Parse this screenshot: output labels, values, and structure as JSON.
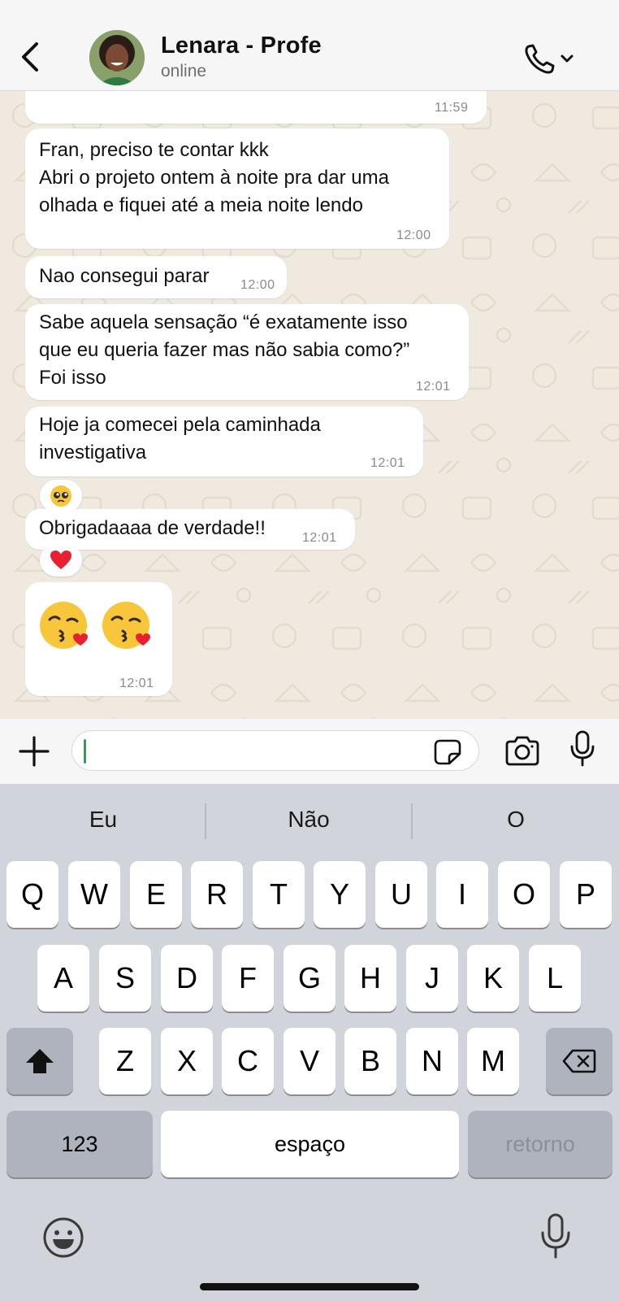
{
  "header": {
    "contact_name": "Lenara - Profe",
    "status": "online",
    "back_icon": "chevron-left-icon",
    "call_icon": "phone-icon"
  },
  "messages": [
    {
      "text": "",
      "time": "11:59"
    },
    {
      "text": "Fran, preciso te contar kkk\nAbri o projeto ontem à noite pra dar uma\nolhada e fiquei até a meia noite lendo",
      "time": "12:00"
    },
    {
      "text": "Nao consegui parar",
      "time": "12:00"
    },
    {
      "text": "Sabe aquela sensação “é exatamente isso\nque eu queria fazer mas não sabia como?”\nFoi isso",
      "time": "12:01"
    },
    {
      "text": "Hoje ja comecei pela caminhada\ninvestigativa",
      "time": "12:01",
      "reaction": "pleading-face"
    },
    {
      "text": "Obrigadaaaa de verdade!!",
      "time": "12:01",
      "reaction": "red-heart"
    },
    {
      "text": "",
      "time": "12:01",
      "emojis": [
        "kissing-heart-face",
        "kissing-heart-face"
      ]
    }
  ],
  "composer": {
    "placeholder": "",
    "value": ""
  },
  "keyboard": {
    "suggestions": [
      "Eu",
      "Não",
      "O"
    ],
    "row1": [
      "Q",
      "W",
      "E",
      "R",
      "T",
      "Y",
      "U",
      "I",
      "O",
      "P"
    ],
    "row2": [
      "A",
      "S",
      "D",
      "F",
      "G",
      "H",
      "J",
      "K",
      "L"
    ],
    "row3": [
      "Z",
      "X",
      "C",
      "V",
      "B",
      "N",
      "M"
    ],
    "numbers_label": "123",
    "space_label": "espaço",
    "return_label": "retorno"
  },
  "colors": {
    "bubble": "#ffffff",
    "wallpaper": "#efe9df",
    "accent_cursor": "#1fa855",
    "keyboard_bg": "#d1d4db"
  }
}
